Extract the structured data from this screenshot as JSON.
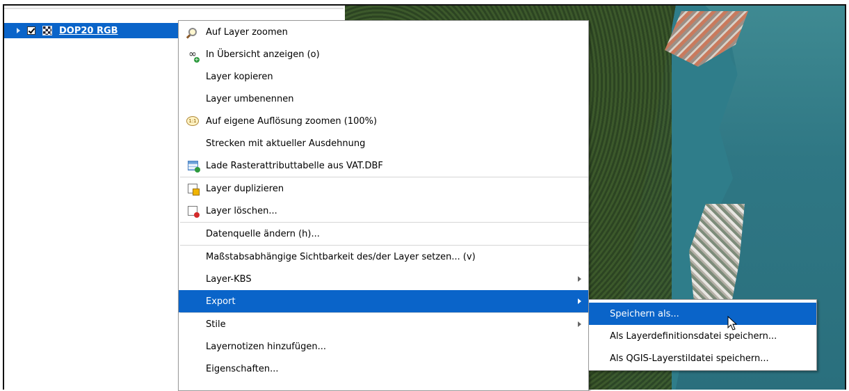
{
  "layer_panel": {
    "layer": {
      "name": "DOP20 RGB",
      "checked": true,
      "icon": "raster-layer-icon"
    }
  },
  "context_menu": {
    "items": [
      {
        "label": "Auf Layer zoomen",
        "icon": "zoom-to-layer-icon"
      },
      {
        "label": "In Übersicht anzeigen (o)",
        "icon": "show-in-overview-icon"
      },
      {
        "label": "Layer kopieren"
      },
      {
        "label": "Layer umbenennen"
      },
      {
        "label": "Auf eigene Auflösung zoomen (100%)",
        "icon": "zoom-native-resolution-icon"
      },
      {
        "label": "Strecken mit aktueller Ausdehnung"
      },
      {
        "label": "Lade Rasterattributtabelle aus VAT.DBF",
        "icon": "attribute-table-icon"
      },
      {
        "label": "Layer duplizieren",
        "icon": "duplicate-layer-icon"
      },
      {
        "label": "Layer löschen...",
        "icon": "remove-layer-icon"
      },
      {
        "label": "Datenquelle ändern (h)..."
      },
      {
        "label": "Maßstabsabhängige Sichtbarkeit des/der Layer setzen... (v)"
      },
      {
        "label": "Layer-KBS",
        "submenu": true
      },
      {
        "label": "Export",
        "submenu": true,
        "highlighted": true
      },
      {
        "label": "Stile",
        "submenu": true
      },
      {
        "label": "Layernotizen hinzufügen..."
      },
      {
        "label": "Eigenschaften..."
      }
    ]
  },
  "export_submenu": {
    "items": [
      {
        "label": "Speichern als...",
        "highlighted": true
      },
      {
        "label": "Als Layerdefinitionsdatei speichern..."
      },
      {
        "label": "Als QGIS-Layerstildatei speichern..."
      }
    ]
  },
  "colors": {
    "highlight": "#0a64c9",
    "menu_bg": "#ffffff",
    "separator": "#d6d6d6"
  }
}
